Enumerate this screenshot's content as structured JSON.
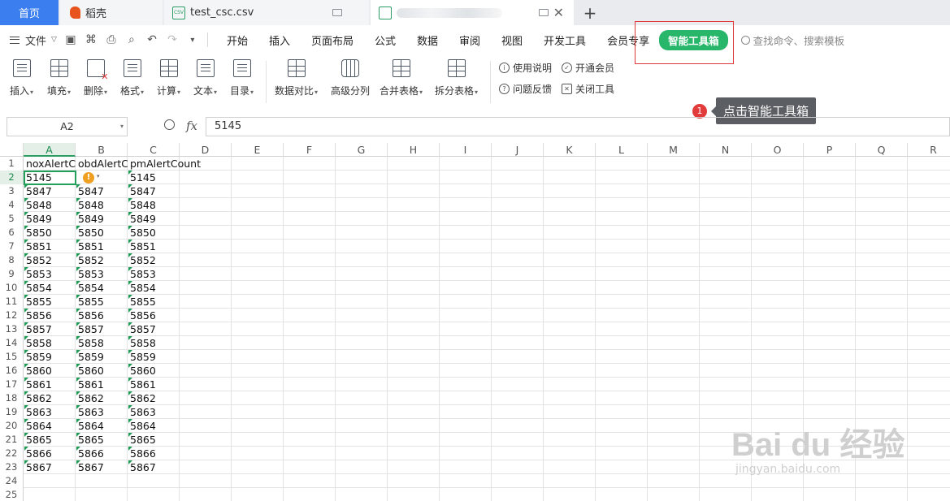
{
  "tabs": {
    "home": "首页",
    "daoke": "稻壳",
    "csv_file": "test_csc.csv",
    "csv_badge": "CSV"
  },
  "menu": {
    "file": "文件",
    "tabs": [
      "开始",
      "插入",
      "页面布局",
      "公式",
      "数据",
      "审阅",
      "视图",
      "开发工具",
      "会员专享"
    ],
    "active_tab": "智能工具箱",
    "search_placeholder": "查找命令、搜索模板"
  },
  "ribbon": {
    "buttons": [
      "插入",
      "填充",
      "删除",
      "格式",
      "计算",
      "文本",
      "目录",
      "数据对比",
      "高级分列",
      "合并表格",
      "拆分表格"
    ],
    "small": [
      "使用说明",
      "开通会员",
      "问题反馈",
      "关闭工具"
    ]
  },
  "callout": {
    "number": "1",
    "text": "点击智能工具箱"
  },
  "formula": {
    "cell_ref": "A2",
    "fx": "fx",
    "value": "5145"
  },
  "sheet": {
    "columns": [
      "A",
      "B",
      "C",
      "D",
      "E",
      "F",
      "G",
      "H",
      "I",
      "J",
      "K",
      "L",
      "M",
      "N",
      "O",
      "P",
      "Q",
      "R"
    ],
    "row_numbers": [
      "1",
      "2",
      "3",
      "4",
      "5",
      "6",
      "7",
      "8",
      "9",
      "10",
      "11",
      "12",
      "13",
      "14",
      "15",
      "16",
      "17",
      "18",
      "19",
      "20",
      "21",
      "22",
      "23",
      "24",
      "25"
    ],
    "headers": [
      "noxAlertCo",
      "obdAlertCo",
      "pmAlertCount"
    ],
    "rows": [
      [
        "5145",
        "",
        "5145"
      ],
      [
        "5847",
        "5847",
        "5847"
      ],
      [
        "5848",
        "5848",
        "5848"
      ],
      [
        "5849",
        "5849",
        "5849"
      ],
      [
        "5850",
        "5850",
        "5850"
      ],
      [
        "5851",
        "5851",
        "5851"
      ],
      [
        "5852",
        "5852",
        "5852"
      ],
      [
        "5853",
        "5853",
        "5853"
      ],
      [
        "5854",
        "5854",
        "5854"
      ],
      [
        "5855",
        "5855",
        "5855"
      ],
      [
        "5856",
        "5856",
        "5856"
      ],
      [
        "5857",
        "5857",
        "5857"
      ],
      [
        "5858",
        "5858",
        "5858"
      ],
      [
        "5859",
        "5859",
        "5859"
      ],
      [
        "5860",
        "5860",
        "5860"
      ],
      [
        "5861",
        "5861",
        "5861"
      ],
      [
        "5862",
        "5862",
        "5862"
      ],
      [
        "5863",
        "5863",
        "5863"
      ],
      [
        "5864",
        "5864",
        "5864"
      ],
      [
        "5865",
        "5865",
        "5865"
      ],
      [
        "5866",
        "5866",
        "5866"
      ],
      [
        "5867",
        "5867",
        "5867"
      ]
    ]
  },
  "watermark": {
    "main": "Bai du 经验",
    "sub": "jingyan.baidu.com"
  }
}
